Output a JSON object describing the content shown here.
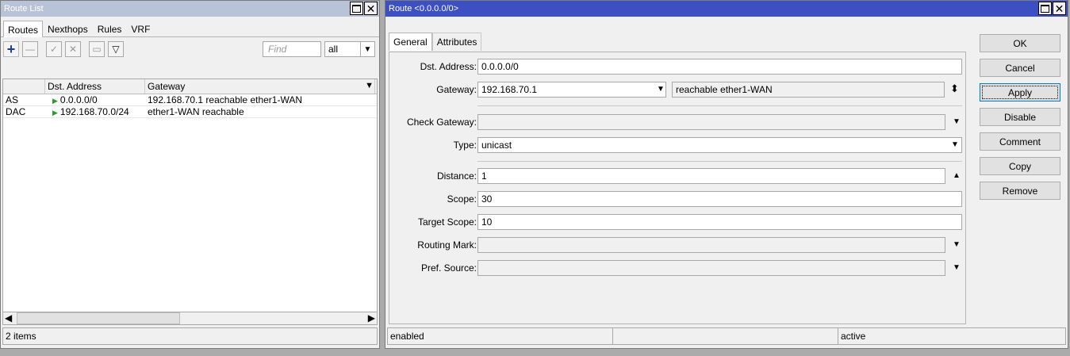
{
  "route_list": {
    "title": "Route List",
    "tabs": [
      "Routes",
      "Nexthops",
      "Rules",
      "VRF"
    ],
    "find_placeholder": "Find",
    "filter_value": "all",
    "columns": [
      "",
      "Dst. Address",
      "Gateway"
    ],
    "rows": [
      {
        "flags": "AS",
        "dst": "0.0.0.0/0",
        "gateway": "192.168.70.1 reachable ether1-WAN"
      },
      {
        "flags": "DAC",
        "dst": "192.168.70.0/24",
        "gateway": "ether1-WAN reachable"
      }
    ],
    "status": "2 items"
  },
  "route_detail": {
    "title": "Route <0.0.0.0/0>",
    "tabs": [
      "General",
      "Attributes"
    ],
    "fields": {
      "dst_address_label": "Dst. Address:",
      "dst_address": "0.0.0.0/0",
      "gateway_label": "Gateway:",
      "gateway": "192.168.70.1",
      "gateway_status": "reachable ether1-WAN",
      "check_gateway_label": "Check Gateway:",
      "check_gateway": "",
      "type_label": "Type:",
      "type": "unicast",
      "distance_label": "Distance:",
      "distance": "1",
      "scope_label": "Scope:",
      "scope": "30",
      "target_scope_label": "Target Scope:",
      "target_scope": "10",
      "routing_mark_label": "Routing Mark:",
      "routing_mark": "",
      "pref_source_label": "Pref. Source:",
      "pref_source": ""
    },
    "buttons": {
      "ok": "OK",
      "cancel": "Cancel",
      "apply": "Apply",
      "disable": "Disable",
      "comment": "Comment",
      "copy": "Copy",
      "remove": "Remove"
    },
    "status": [
      "enabled",
      "",
      "active"
    ]
  }
}
